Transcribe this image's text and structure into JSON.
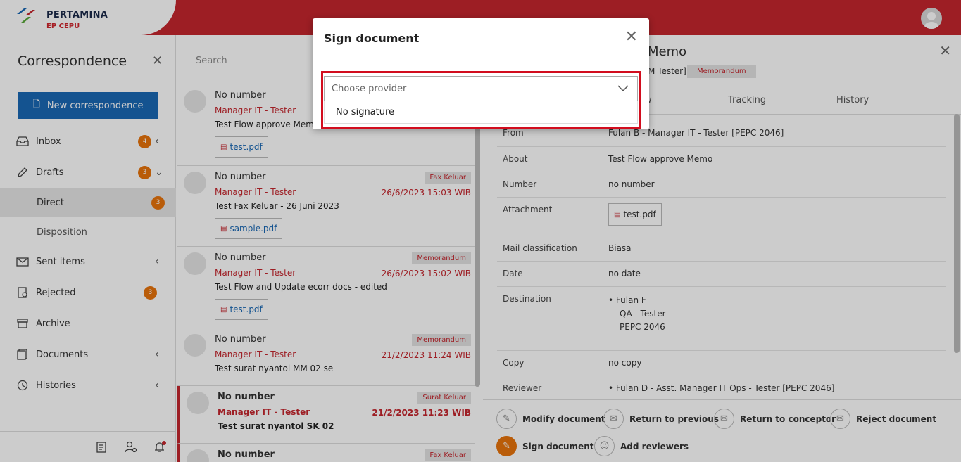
{
  "brand": {
    "name": "PERTAMINA",
    "sub": "EP CEPU"
  },
  "sidebar": {
    "title": "Correspondence",
    "new_label": "New correspondence",
    "items": [
      {
        "label": "Inbox",
        "badge": "4"
      },
      {
        "label": "Drafts",
        "badge": "3"
      },
      {
        "label": "Direct",
        "badge": "3"
      },
      {
        "label": "Disposition"
      },
      {
        "label": "Sent items"
      },
      {
        "label": "Rejected",
        "badge": "3"
      },
      {
        "label": "Archive"
      },
      {
        "label": "Documents"
      },
      {
        "label": "Histories"
      }
    ]
  },
  "list": {
    "search_placeholder": "Search",
    "items": [
      {
        "number": "No number",
        "sender": "Manager IT - Tester",
        "subject": "Test Flow approve Memo",
        "attachment": "test.pdf",
        "tag": "",
        "date": ""
      },
      {
        "number": "No number",
        "sender": "Manager IT - Tester",
        "subject": "Test Fax Keluar - 26 Juni 2023",
        "attachment": "sample.pdf",
        "tag": "Fax Keluar",
        "date": "26/6/2023 15:03 WIB"
      },
      {
        "number": "No number",
        "sender": "Manager IT - Tester",
        "subject": "Test Flow and Update ecorr docs - edited",
        "attachment": "test.pdf",
        "tag": "Memorandum",
        "date": "26/6/2023 15:02 WIB"
      },
      {
        "number": "No number",
        "sender": "Manager IT - Tester",
        "subject": "Test surat nyantol MM 02 se",
        "attachment": "",
        "tag": "Memorandum",
        "date": "21/2/2023 11:24 WIB"
      },
      {
        "number": "No number",
        "sender": "Manager IT - Tester",
        "subject": "Test surat nyantol SK 02",
        "attachment": "",
        "tag": "Surat Keluar",
        "date": "21/2/2023 11:23 WIB"
      },
      {
        "number": "No number",
        "sender": "",
        "subject": "",
        "attachment": "",
        "tag": "Fax Keluar",
        "date": ""
      }
    ]
  },
  "detail": {
    "title": "Memo",
    "subtitle": "M Tester]",
    "chip": "Memorandum",
    "tabs": [
      "w",
      "Tracking",
      "History"
    ],
    "fields": {
      "from_k": "From",
      "from_v": "Fulan B - Manager IT - Tester [PEPC 2046]",
      "about_k": "About",
      "about_v": "Test Flow approve Memo",
      "number_k": "Number",
      "number_v": "no number",
      "attach_k": "Attachment",
      "attach_v": "test.pdf",
      "class_k": "Mail classification",
      "class_v": "Biasa",
      "date_k": "Date",
      "date_v": "no date",
      "dest_k": "Destination",
      "dest_name": "Fulan F",
      "dest_role": "QA - Tester",
      "dest_code": "PEPC 2046",
      "copy_k": "Copy",
      "copy_v": "no copy",
      "rev_k": "Reviewer",
      "rev_v": "Fulan D - Asst. Manager IT Ops - Tester [PEPC 2046]"
    },
    "actions": {
      "modify": "Modify document",
      "return_prev": "Return to previous",
      "return_conc": "Return to conceptor",
      "reject": "Reject document",
      "sign": "Sign document",
      "add_rev": "Add reviewers"
    }
  },
  "modal": {
    "title": "Sign document",
    "select_placeholder": "Choose provider",
    "option": "No signature"
  },
  "colors": {
    "brand_red": "#c5262e",
    "accent_blue": "#1a68b4",
    "badge_orange": "#e8730c",
    "highlight": "#d20d1e"
  }
}
